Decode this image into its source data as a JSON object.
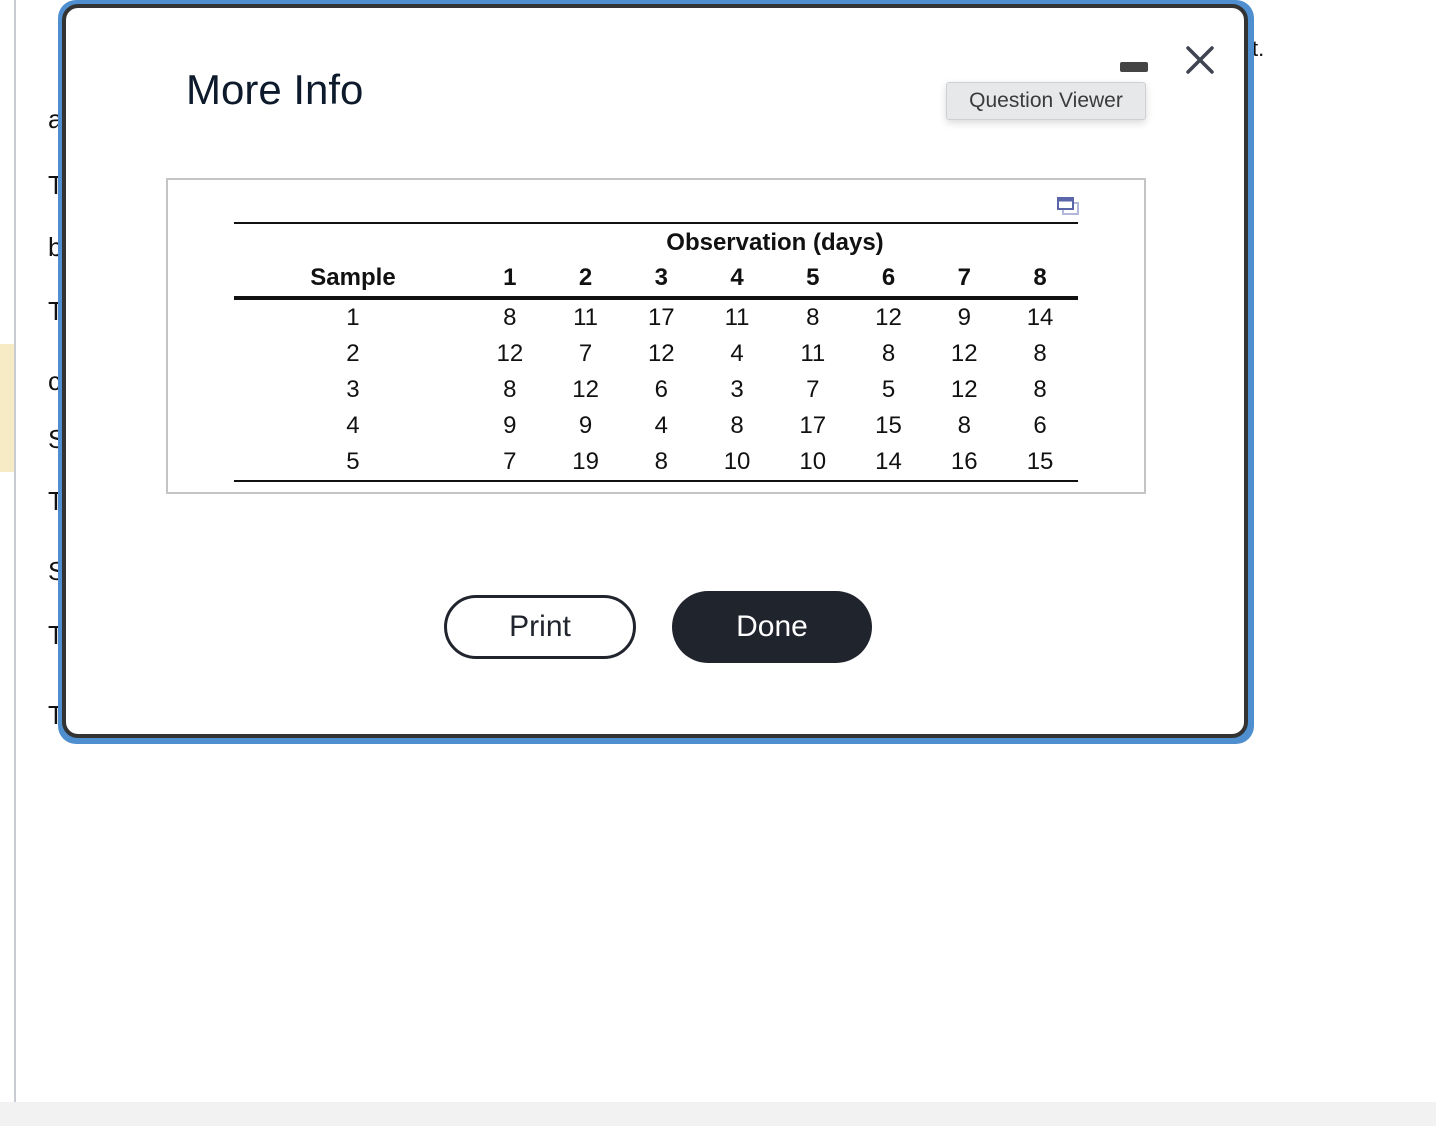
{
  "background": {
    "letters": [
      "a",
      "T",
      "b",
      "T",
      "c",
      "S",
      "T",
      "S",
      "T",
      "T"
    ],
    "tail_text": "t."
  },
  "dialog": {
    "title": "More Info",
    "tooltip": "Question Viewer",
    "icons": {
      "minimize": "minimize-icon",
      "close": "close-icon",
      "expand": "expand-window-icon"
    },
    "buttons": {
      "print": "Print",
      "done": "Done"
    }
  },
  "table": {
    "group_header": "Observation (days)",
    "row_header": "Sample",
    "columns": [
      "1",
      "2",
      "3",
      "4",
      "5",
      "6",
      "7",
      "8"
    ],
    "rows": [
      {
        "sample": "1",
        "values": [
          "8",
          "11",
          "17",
          "11",
          "8",
          "12",
          "9",
          "14"
        ]
      },
      {
        "sample": "2",
        "values": [
          "12",
          "7",
          "12",
          "4",
          "11",
          "8",
          "12",
          "8"
        ]
      },
      {
        "sample": "3",
        "values": [
          "8",
          "12",
          "6",
          "3",
          "7",
          "5",
          "12",
          "8"
        ]
      },
      {
        "sample": "4",
        "values": [
          "9",
          "9",
          "4",
          "8",
          "17",
          "15",
          "8",
          "6"
        ]
      },
      {
        "sample": "5",
        "values": [
          "7",
          "19",
          "8",
          "10",
          "10",
          "14",
          "16",
          "15"
        ]
      }
    ]
  }
}
